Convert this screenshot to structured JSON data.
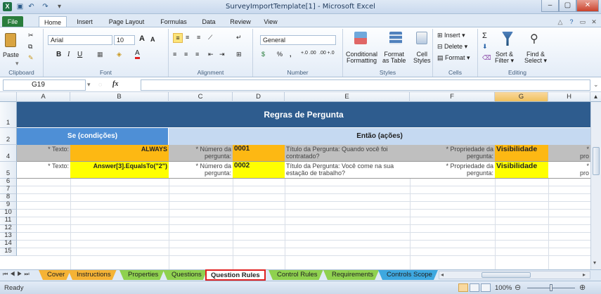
{
  "window": {
    "title": "SurveyImportTemplate[1] - Microsoft Excel",
    "controls": [
      "–",
      "▢",
      "✕"
    ]
  },
  "ribbon_tabs": [
    "File",
    "Home",
    "Insert",
    "Page Layout",
    "Formulas",
    "Data",
    "Review",
    "View"
  ],
  "ribbon": {
    "clipboard": {
      "paste": "Paste",
      "label": "Clipboard"
    },
    "font": {
      "name": "Arial",
      "size": "10",
      "label": "Font",
      "bold": "B",
      "italic": "I",
      "underline": "U",
      "grow": "A",
      "shrink": "A",
      "font_color_letter": "A"
    },
    "alignment": {
      "label": "Alignment"
    },
    "number": {
      "format": "General",
      "label": "Number",
      "percent": "%",
      "comma": ",",
      "inc": "+.0 .00",
      "dec": ".00 +.0",
      "currency": "$"
    },
    "styles": {
      "conditional": "Conditional",
      "conditional2": "Formatting",
      "format_table": "Format",
      "format_table2": "as Table",
      "cell_styles": "Cell",
      "cell_styles2": "Styles",
      "label": "Styles"
    },
    "cells": {
      "insert": "Insert",
      "delete": "Delete",
      "format": "Format",
      "label": "Cells"
    },
    "editing": {
      "sigma": "Σ",
      "sort": "Sort &",
      "sort2": "Filter",
      "find": "Find &",
      "find2": "Select",
      "label": "Editing"
    }
  },
  "formula_bar": {
    "name_box": "G19",
    "fx": "fx",
    "value": ""
  },
  "columns": [
    "A",
    "B",
    "C",
    "D",
    "E",
    "F",
    "G",
    "H"
  ],
  "selected_column": "G",
  "rows": [
    "1",
    "2",
    "4",
    "5",
    "6",
    "7",
    "8",
    "9",
    "10",
    "11",
    "12",
    "13",
    "14",
    "15"
  ],
  "sheet": {
    "title": "Regras de Pergunta",
    "if_header": "Se (condições)",
    "then_header": "Então (ações)",
    "data_rows": [
      {
        "row": "4",
        "label_a": "* Texto:",
        "value_b": "ALWAYS",
        "label_c1": "* Número da",
        "label_c2": "pergunta:",
        "value_d": "0001",
        "title_e1": "Título da Pergunta: Quando você foi",
        "title_e2": "contratado?",
        "label_f1": "* Propriedade da",
        "label_f2": "pergunta:",
        "value_g": "Visibilidade",
        "partial_h": "*",
        "partial_h2": "pro"
      },
      {
        "row": "5",
        "label_a": "* Texto:",
        "value_b": "Answer[3].EqualsTo(\"2\")",
        "label_c1": "* Número da",
        "label_c2": "pergunta:",
        "value_d": "0002",
        "title_e1": "Título da Pergunta: Você come na sua",
        "title_e2": "estação de trabalho?",
        "label_f1": "* Propriedade da",
        "label_f2": "pergunta:",
        "value_g": "Visibilidade",
        "partial_h": "*",
        "partial_h2": "pro"
      }
    ]
  },
  "sheet_tabs": [
    {
      "label": "Cover",
      "color": "#f5b335"
    },
    {
      "label": "Instructions",
      "color": "#f5b335"
    },
    {
      "label": "Properties",
      "color": "#8fd14f"
    },
    {
      "label": "Questions",
      "color": "#8fd14f"
    },
    {
      "label": "Question Rules",
      "color": "#f5b335",
      "active": true
    },
    {
      "label": "Control Rules",
      "color": "#8fd14f"
    },
    {
      "label": "Requirements",
      "color": "#8fd14f"
    },
    {
      "label": "Controls Scope",
      "color": "#3ea8e0"
    }
  ],
  "status": {
    "text": "Ready",
    "zoom": "100%"
  },
  "colors": {
    "header_blue": "#2e5c8e",
    "if_blue": "#4e8fd6",
    "then_blue": "#c5d9f1",
    "label_gray": "#bfbfbf",
    "orange": "#fdb813",
    "yellow": "#ffff00",
    "tab_highlight": "#e02020"
  }
}
